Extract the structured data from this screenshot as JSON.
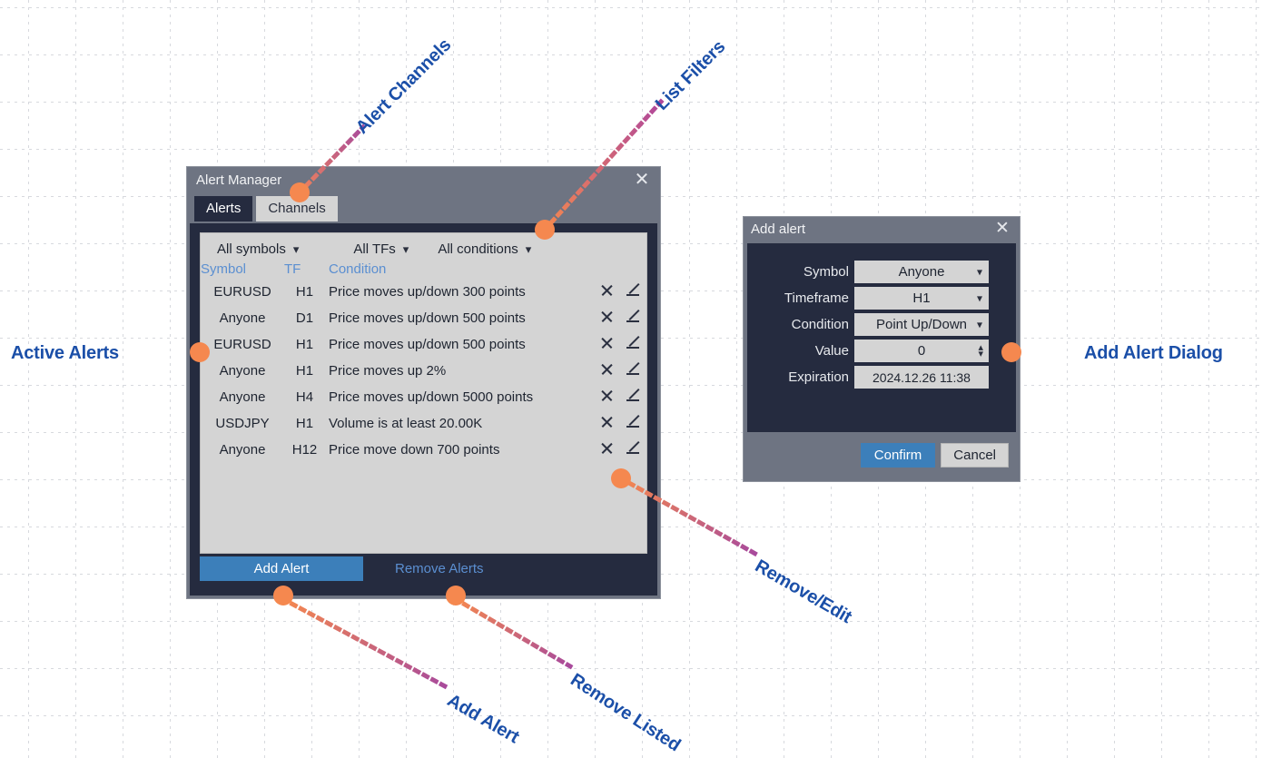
{
  "alert_manager": {
    "title": "Alert Manager",
    "close_icon": "close-icon",
    "tabs": [
      {
        "label": "Alerts",
        "active": true
      },
      {
        "label": "Channels",
        "active": false
      }
    ],
    "filters": [
      {
        "label": "All symbols",
        "icon": "chevron-down-icon"
      },
      {
        "label": "All TFs",
        "icon": "chevron-down-icon"
      },
      {
        "label": "All conditions",
        "icon": "chevron-down-icon"
      }
    ],
    "columns": [
      "Symbol",
      "TF",
      "Condition"
    ],
    "rows": [
      {
        "symbol": "EURUSD",
        "tf": "H1",
        "condition": "Price moves up/down 300 points"
      },
      {
        "symbol": "Anyone",
        "tf": "D1",
        "condition": "Price moves up/down 500 points"
      },
      {
        "symbol": "EURUSD",
        "tf": "H1",
        "condition": "Price moves up/down 500 points"
      },
      {
        "symbol": "Anyone",
        "tf": "H1",
        "condition": "Price moves up 2%"
      },
      {
        "symbol": "Anyone",
        "tf": "H4",
        "condition": "Price moves up/down 5000 points"
      },
      {
        "symbol": "USDJPY",
        "tf": "H1",
        "condition": "Volume is at least 20.00K"
      },
      {
        "symbol": "Anyone",
        "tf": "H12",
        "condition": "Price move down 700 points"
      }
    ],
    "add_alert_button": "Add Alert",
    "remove_alerts_button": "Remove Alerts"
  },
  "add_alert_dialog": {
    "title": "Add alert",
    "close_icon": "close-icon",
    "fields": [
      {
        "label": "Symbol",
        "value": "Anyone",
        "control": "select"
      },
      {
        "label": "Timeframe",
        "value": "H1",
        "control": "select"
      },
      {
        "label": "Condition",
        "value": "Point Up/Down",
        "control": "select"
      },
      {
        "label": "Value",
        "value": "0",
        "control": "spinner"
      },
      {
        "label": "Expiration",
        "value": "2024.12.26  11:38",
        "control": "text"
      }
    ],
    "confirm_button": "Confirm",
    "cancel_button": "Cancel"
  },
  "annotations": [
    {
      "text": "Alert Channels",
      "angle": -45
    },
    {
      "text": "List Filters",
      "angle": -45
    },
    {
      "text": "Active Alerts",
      "angle": 0
    },
    {
      "text": "Add Alert Dialog",
      "angle": 0
    },
    {
      "text": "Remove/Edit",
      "angle": 30
    },
    {
      "text": "Remove Listed",
      "angle": 35
    },
    {
      "text": "Add Alert",
      "angle": 30
    }
  ],
  "colors": {
    "accent_blue": "#3c7fba",
    "label_blue": "#1b4fa8",
    "link_blue": "#5b8fd1",
    "dot_orange": "#f5884f",
    "window_dark": "#252b3f",
    "titlebar_gray": "#6e7482",
    "panel_gray": "#d4d4d4"
  }
}
